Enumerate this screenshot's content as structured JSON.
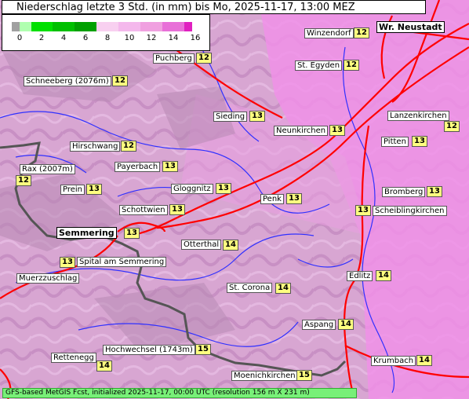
{
  "title": "Niederschlag letzte 3 Std. (in mm) bis Mo, 2025-11-17, 13:00 MEZ",
  "legend": {
    "ticks": [
      "0",
      "2",
      "4",
      "6",
      "8",
      "10",
      "12",
      "14",
      "16"
    ],
    "colors": [
      "#a0a0a0",
      "#b0ffb0",
      "#00e000",
      "#00c000",
      "#00a000",
      "#f8d0f0",
      "#f0a0e0",
      "#e870d8",
      "#e020c0"
    ]
  },
  "places": [
    {
      "name": "Wr. Neustadt",
      "big": true
    },
    {
      "name": "Winzendorf",
      "value": "12"
    },
    {
      "name": "Puchberg",
      "value": "12"
    },
    {
      "name": "St. Egyden",
      "value": "12"
    },
    {
      "name": "Schneeberg (2076m)",
      "value": "12"
    },
    {
      "name": "Sieding",
      "value": "13"
    },
    {
      "name": "Lanzenkirchen",
      "value": "12"
    },
    {
      "name": "Neunkirchen",
      "value": "13"
    },
    {
      "name": "Hirschwang",
      "value": "12"
    },
    {
      "name": "Pitten",
      "value": "13"
    },
    {
      "name": "Rax (2007m)",
      "value": "12"
    },
    {
      "name": "Payerbach",
      "value": "13"
    },
    {
      "name": "Prein",
      "value": "13"
    },
    {
      "name": "Gloggnitz",
      "value": "13"
    },
    {
      "name": "Bromberg",
      "value": "13"
    },
    {
      "name": "Penk",
      "value": "13"
    },
    {
      "name": "Schottwien",
      "value": "13"
    },
    {
      "name": "Scheiblingkirchen",
      "value": "13"
    },
    {
      "name": "Semmering",
      "value": "13",
      "big": true
    },
    {
      "name": "Otterthal",
      "value": "14"
    },
    {
      "name": "Spital am Semmering",
      "value": "13"
    },
    {
      "name": "Muerzzuschlag"
    },
    {
      "name": "Edlitz",
      "value": "14"
    },
    {
      "name": "St. Corona",
      "value": "14"
    },
    {
      "name": "Aspang",
      "value": "14"
    },
    {
      "name": "Hochwechsel (1743m)",
      "value": "15"
    },
    {
      "name": "Rettenegg",
      "value": "14"
    },
    {
      "name": "Krumbach",
      "value": "14"
    },
    {
      "name": "Moenichkirchen",
      "value": "15"
    }
  ],
  "footer": "GFS-based MetGIS Fcst, initialized 2025-11-17, 00:00 UTC  (resolution 156 m X 231 m)"
}
